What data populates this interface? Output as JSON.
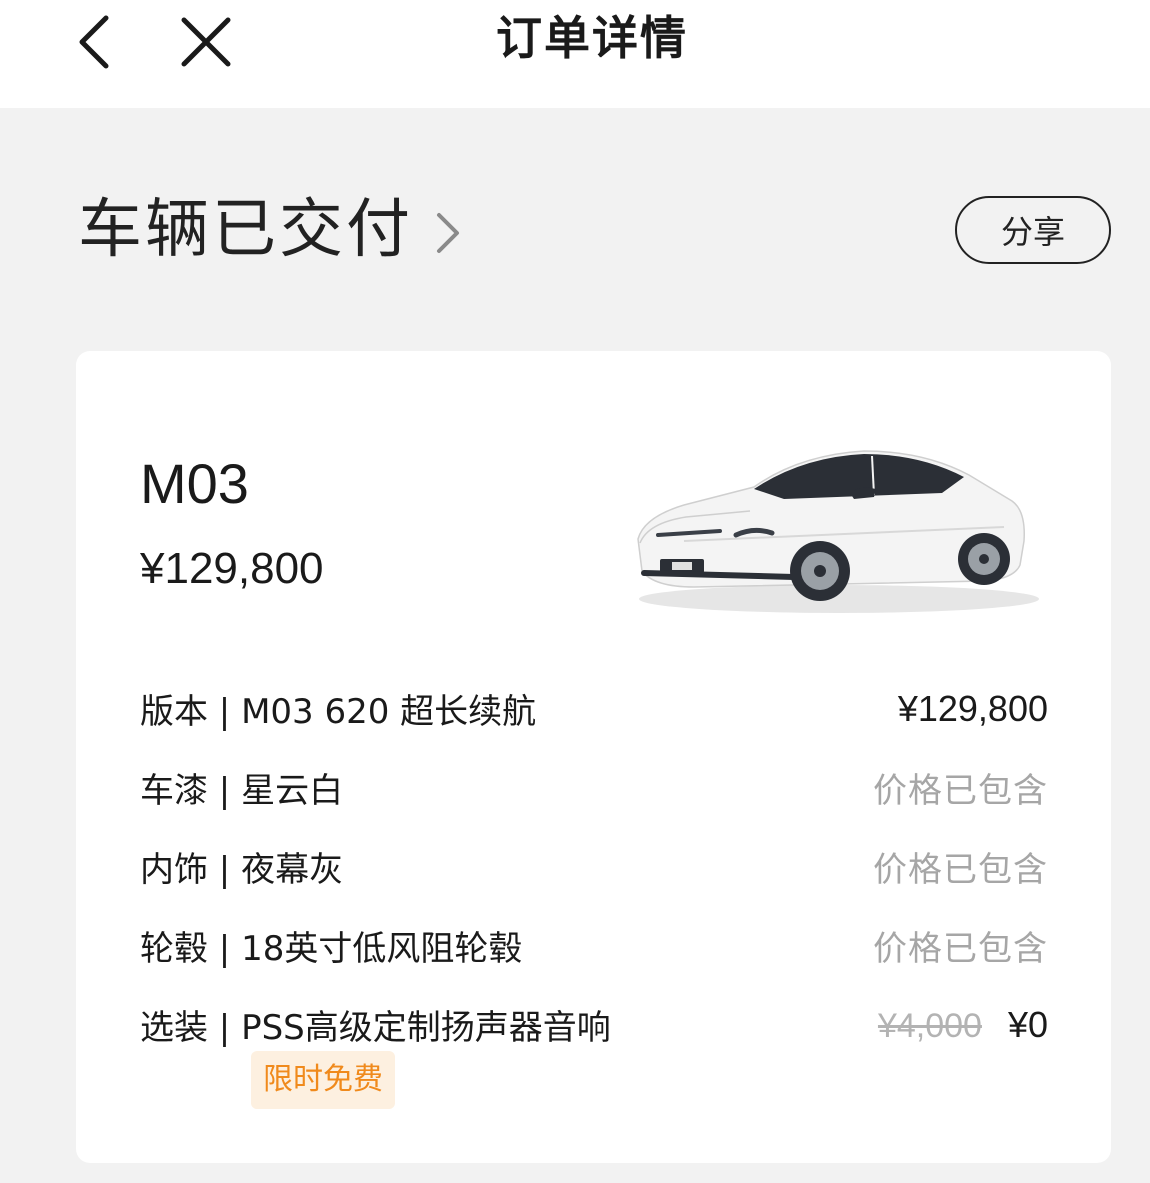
{
  "header": {
    "title": "订单详情"
  },
  "status": {
    "text": "车辆已交付",
    "share_label": "分享"
  },
  "vehicle": {
    "model": "M03",
    "price": "¥129,800"
  },
  "specs": [
    {
      "label": "版本 | M03 620 超长续航",
      "value": "¥129,800"
    },
    {
      "label": "车漆 | 星云白",
      "value": "价格已包含"
    },
    {
      "label": "内饰 | 夜幕灰",
      "value": "价格已包含"
    },
    {
      "label": "轮毂 | 18英寸低风阻轮毂",
      "value": "价格已包含"
    },
    {
      "label": "选装 | PSS高级定制扬声器音响",
      "original_price": "¥4,000",
      "value": "¥0"
    }
  ],
  "promo": {
    "label": "限时免费"
  },
  "colors": {
    "background": "#f2f2f2",
    "card": "#ffffff",
    "muted": "#a6a6a6",
    "promo_text": "#f08a1c",
    "promo_bg": "#fdf0e0"
  }
}
